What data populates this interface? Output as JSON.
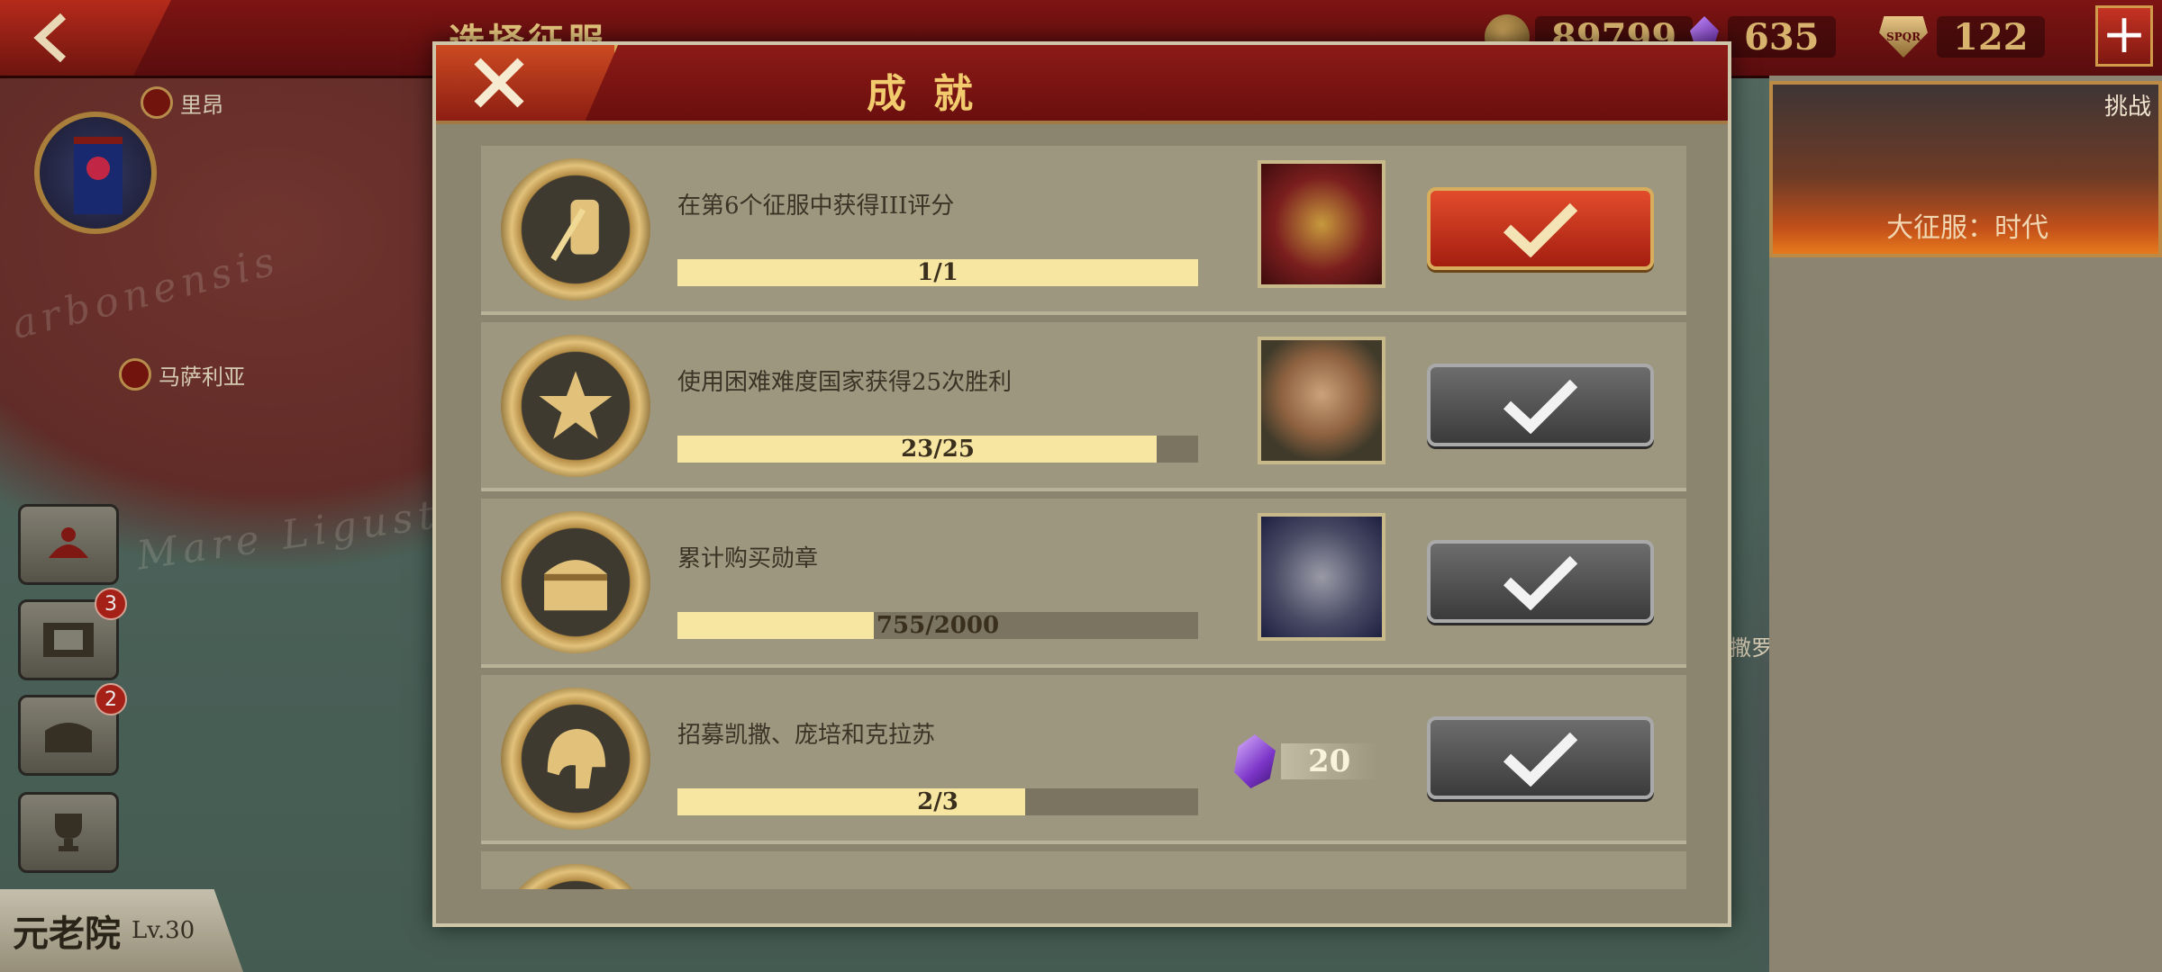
{
  "header": {
    "page_title": "选择征服",
    "resources": [
      {
        "icon": "gold-coin-icon",
        "value": "89799"
      },
      {
        "icon": "purple-gem-icon",
        "value": "635"
      },
      {
        "icon": "spqr-emblem-icon",
        "value": "122"
      }
    ],
    "plus_label": "+"
  },
  "map": {
    "cities": [
      "里昂",
      "马萨利亚"
    ],
    "region_words": [
      "arbonensis",
      "Mare  Ligusticum"
    ],
    "right_city": "撒罗"
  },
  "sidebar": {
    "badges": {
      "video": "3",
      "chest": "2"
    }
  },
  "senate": {
    "name": "元老院",
    "level": "Lv.30"
  },
  "challenge": {
    "tag": "挑战",
    "title": "大征服：时代"
  },
  "modal": {
    "title": "成就",
    "achievements": [
      {
        "name": "在第6个征服中获得III评分",
        "progress": "1/1",
        "fraction": 1.0,
        "medal": "sword-shield-medal-icon",
        "reward": "spartan-helmet-icon",
        "claimable": true
      },
      {
        "name": "使用困难难度国家获得25次胜利",
        "progress": "23/25",
        "fraction": 0.92,
        "medal": "star-medal-icon",
        "reward": "scroll-icon",
        "claimable": false
      },
      {
        "name": "累计购买勋章",
        "progress": "755/2000",
        "fraction": 0.3775,
        "medal": "treasure-chest-medal-icon",
        "reward": "book-icon",
        "claimable": false
      },
      {
        "name": "招募凯撒、庞培和克拉苏",
        "progress": "2/3",
        "fraction": 0.667,
        "medal": "helmet-medal-icon",
        "reward_gem": "20",
        "claimable": false
      }
    ]
  },
  "colors": {
    "accent": "#f1cb6d",
    "header_red": "#8c1a16",
    "claim_red": "#e24c2b",
    "bar_fill": "#f6e6a2"
  }
}
